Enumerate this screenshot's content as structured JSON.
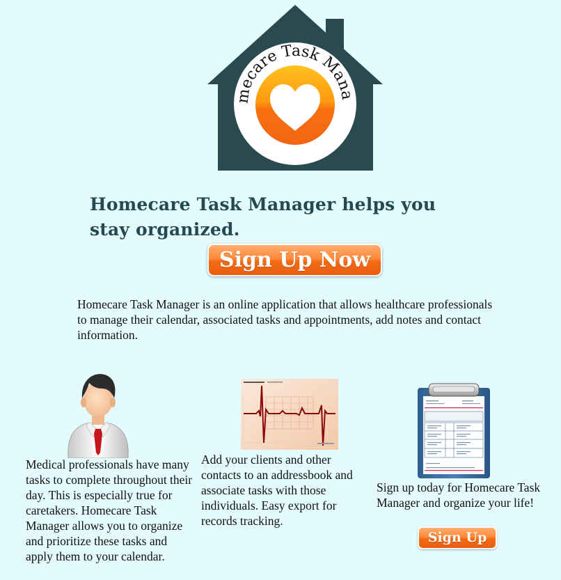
{
  "logo": {
    "text": "Homecare Task Manager",
    "icon": "heart-icon"
  },
  "headline": "Homecare Task Manager helps you stay organized.",
  "signup_now_label": "Sign Up Now",
  "intro": "Homecare Task Manager is an online application that allows healthcare professionals to manage their calendar, associated tasks and appointments, add notes and contact information.",
  "features": [
    {
      "icon": "doctor-icon",
      "text": "Medical professionals have many tasks to complete throughout their day. This is especially true for caretakers. Homecare Task Manager allows you to organize and prioritize these tasks and apply them to your calendar."
    },
    {
      "icon": "ekg-chart-icon",
      "text": "Add your clients and other contacts to an addressbook and associate tasks with those individuals. Easy export for records tracking."
    },
    {
      "icon": "clipboard-icon",
      "text": "Sign up today for Homecare Task Manager and organize your life!"
    }
  ],
  "signup_label": "Sign Up",
  "colors": {
    "background": "#e3fbfd",
    "house": "#2a4a52",
    "heading": "#234a52",
    "button": "#f26a14",
    "sun_light": "#ffb020",
    "sun_dark": "#f56a10"
  }
}
